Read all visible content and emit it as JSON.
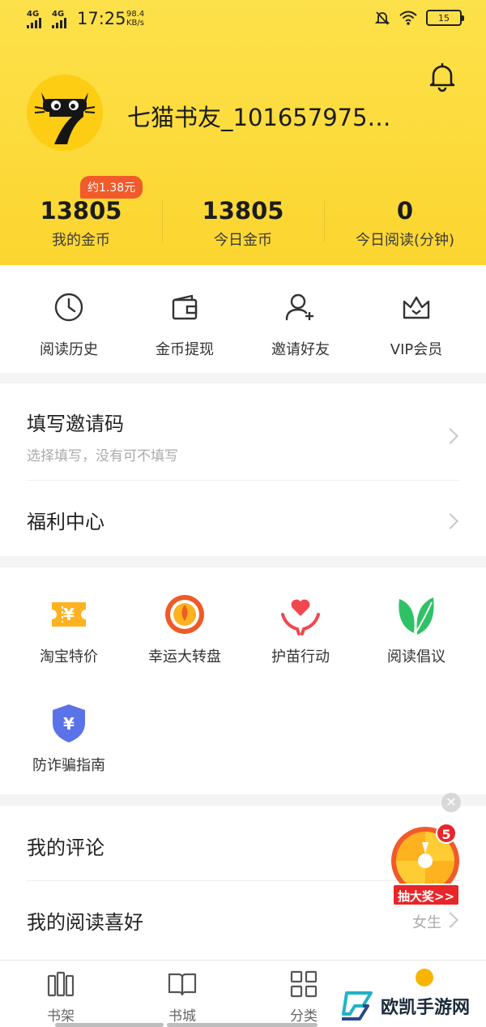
{
  "status_bar": {
    "network_1": "4G",
    "network_2": "4G",
    "time": "17:25",
    "speed_value": "98.4",
    "speed_unit": "KB/s",
    "battery": "15"
  },
  "profile": {
    "username": "七猫书友_101657975…",
    "badge": "约1.38元"
  },
  "stats": [
    {
      "value": "13805",
      "label": "我的金币"
    },
    {
      "value": "13805",
      "label": "今日金币"
    },
    {
      "value": "0",
      "label": "今日阅读(分钟)"
    }
  ],
  "quick_actions": [
    {
      "label": "阅读历史",
      "icon": "clock-icon"
    },
    {
      "label": "金币提现",
      "icon": "wallet-icon"
    },
    {
      "label": "邀请好友",
      "icon": "add-user-icon"
    },
    {
      "label": "VIP会员",
      "icon": "crown-icon"
    }
  ],
  "menu_rows": {
    "invite_code": {
      "title": "填写邀请码",
      "subtitle": "选择填写，没有可不填写"
    },
    "welfare": {
      "title": "福利中心"
    }
  },
  "services": [
    {
      "label": "淘宝特价",
      "icon": "coupon-icon"
    },
    {
      "label": "幸运大转盘",
      "icon": "wheel-icon"
    },
    {
      "label": "护苗行动",
      "icon": "heart-hands-icon"
    },
    {
      "label": "阅读倡议",
      "icon": "leaf-icon"
    },
    {
      "label": "防诈骗指南",
      "icon": "shield-icon"
    }
  ],
  "bottom_rows": {
    "comments": {
      "title": "我的评论"
    },
    "preference": {
      "title": "我的阅读喜好",
      "value": "女生"
    }
  },
  "floating_prize": {
    "count": "5",
    "label": "抽大奖>>"
  },
  "bottom_nav": [
    {
      "label": "书架",
      "icon": "bookshelf-icon"
    },
    {
      "label": "书城",
      "icon": "book-icon"
    },
    {
      "label": "分类",
      "icon": "grid-icon"
    }
  ],
  "watermark": "欧凯手游网",
  "colors": {
    "header_yellow": "#fcd52f",
    "badge_orange": "#f15a2a",
    "prize_red": "#e8262a"
  }
}
